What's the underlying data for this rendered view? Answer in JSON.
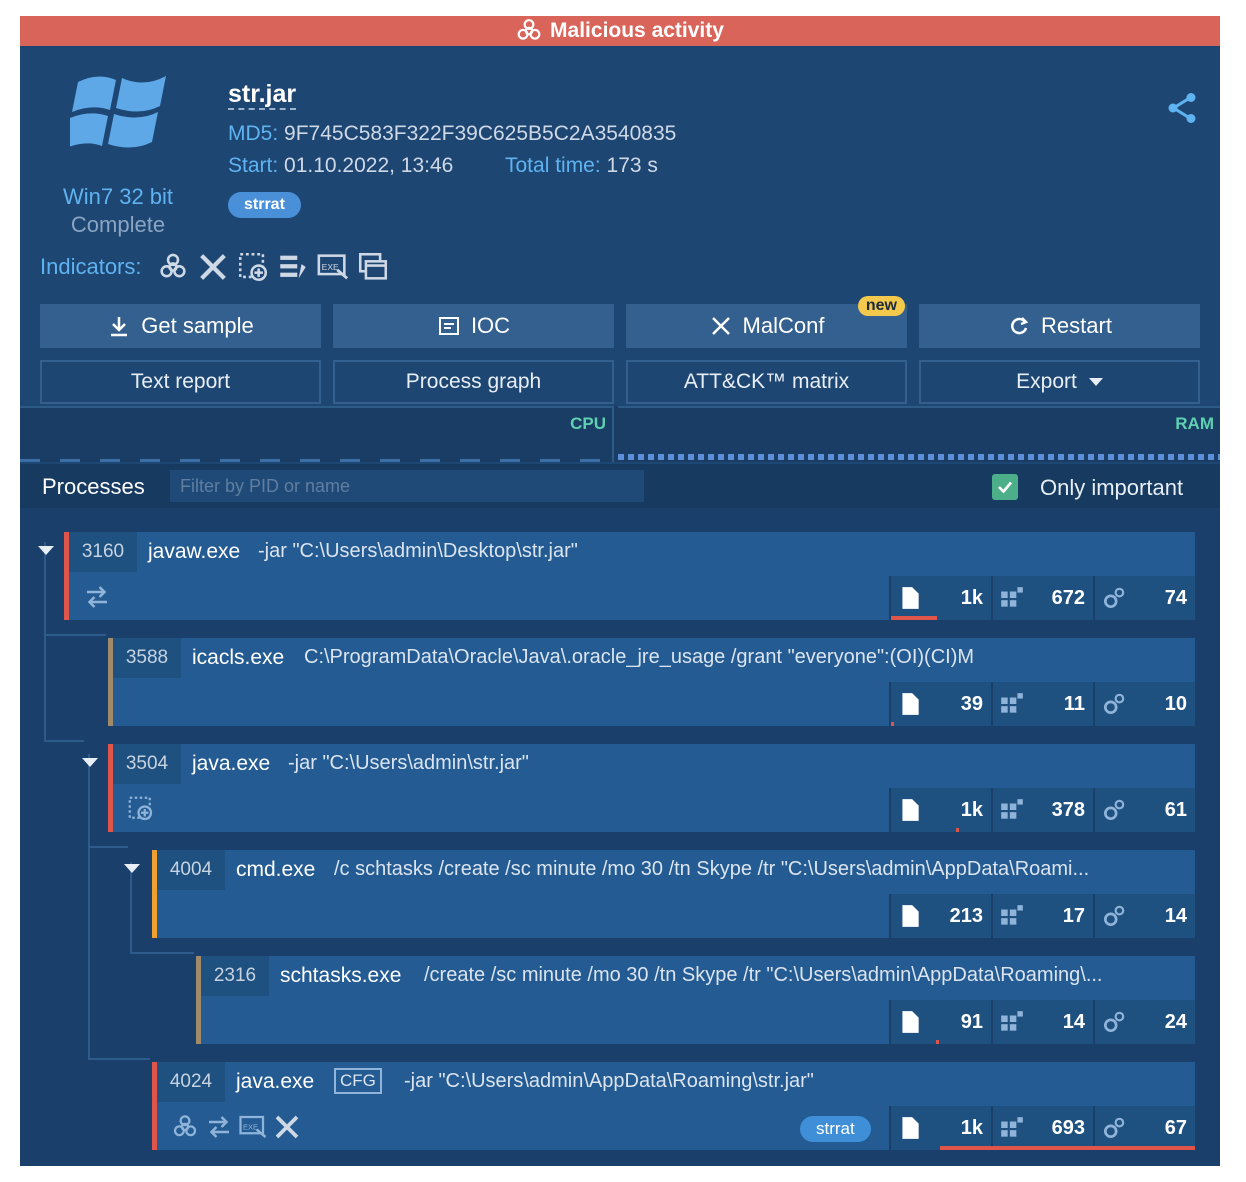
{
  "banner": {
    "text": "Malicious activity"
  },
  "os": {
    "name": "Win7 32 bit",
    "status": "Complete"
  },
  "file": {
    "name": "str.jar",
    "md5_label": "MD5:",
    "md5": "9F745C583F322F39C625B5C2A3540835",
    "start_label": "Start:",
    "start": "01.10.2022, 13:46",
    "total_label": "Total time:",
    "total": "173 s",
    "tag": "strrat"
  },
  "indicators": {
    "label": "Indicators:",
    "icons": [
      "biohazard-icon",
      "tools-icon",
      "network-icon",
      "registry-icon",
      "executable-icon",
      "windows-icon"
    ]
  },
  "actions": {
    "get_sample": "Get sample",
    "ioc": "IOC",
    "malconf": "MalConf",
    "malconf_badge": "new",
    "restart": "Restart",
    "text_report": "Text report",
    "process_graph": "Process graph",
    "attck": "ATT&CK™ matrix",
    "export": "Export"
  },
  "perf": {
    "cpu_label": "CPU",
    "ram_label": "RAM"
  },
  "processes": {
    "title": "Processes",
    "filter_placeholder": "Filter by PID or name",
    "only_important_label": "Only important",
    "only_important": true,
    "items": [
      {
        "pid": "3160",
        "name": "javaw.exe",
        "cmd": "-jar \"C:\\Users\\admin\\Desktop\\str.jar\"",
        "files": "1k",
        "registry": "672",
        "modules": "74",
        "bar_color": "#e0554a"
      },
      {
        "pid": "3588",
        "name": "icacls.exe",
        "cmd": "C:\\ProgramData\\Oracle\\Java\\.oracle_jre_usage /grant \"everyone\":(OI)(CI)M",
        "files": "39",
        "registry": "11",
        "modules": "10",
        "bar_color": "#a08a6a"
      },
      {
        "pid": "3504",
        "name": "java.exe",
        "cmd": "-jar \"C:\\Users\\admin\\str.jar\"",
        "files": "1k",
        "registry": "378",
        "modules": "61",
        "bar_color": "#e0554a"
      },
      {
        "pid": "4004",
        "name": "cmd.exe",
        "cmd": "/c schtasks /create /sc minute /mo 30 /tn Skype /tr \"C:\\Users\\admin\\AppData\\Roami...",
        "files": "213",
        "registry": "17",
        "modules": "14",
        "bar_color": "#f0a030"
      },
      {
        "pid": "2316",
        "name": "schtasks.exe",
        "cmd": "/create /sc minute /mo 30 /tn Skype /tr \"C:\\Users\\admin\\AppData\\Roaming\\...",
        "files": "91",
        "registry": "14",
        "modules": "24",
        "bar_color": "#a08a6a"
      },
      {
        "pid": "4024",
        "name": "java.exe",
        "cfg": "CFG",
        "cmd": "-jar \"C:\\Users\\admin\\AppData\\Roaming\\str.jar\"",
        "tag": "strrat",
        "files": "1k",
        "registry": "693",
        "modules": "67",
        "bar_color": "#e0554a"
      }
    ]
  }
}
